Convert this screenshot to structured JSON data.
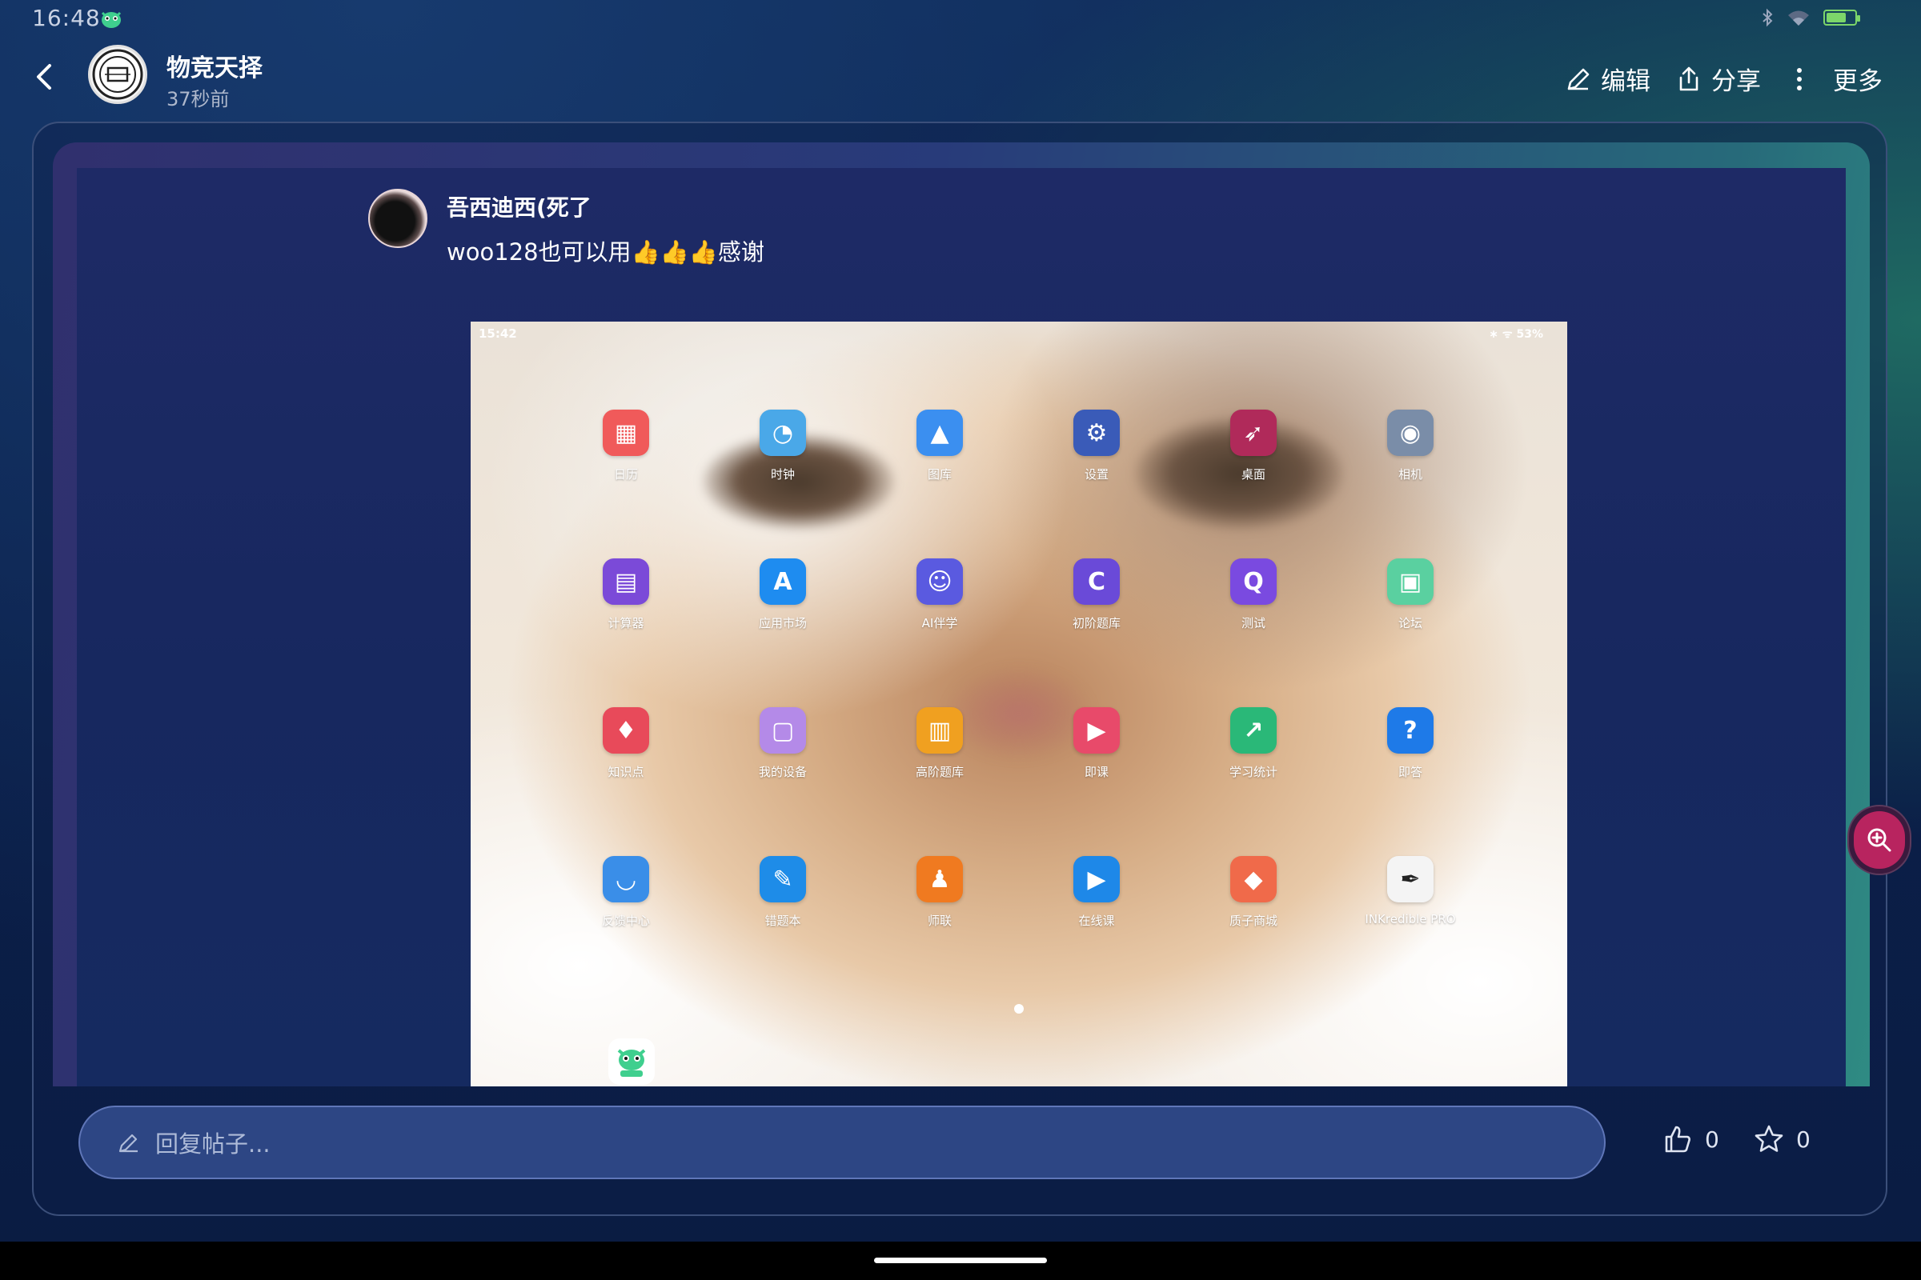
{
  "status_bar": {
    "time": "16:48",
    "app_icon": "green-monster-app-icon",
    "icons": [
      "bluetooth-icon",
      "wifi-icon",
      "battery-icon"
    ]
  },
  "header": {
    "forum_name": "物竞天择",
    "post_time": "37秒前",
    "actions": {
      "edit": "编辑",
      "share": "分享",
      "more": "更多"
    }
  },
  "reply": {
    "username": "吾西迪西(死了",
    "text": "woo128也可以用👍👍👍感谢"
  },
  "image": {
    "status_time": "15:42",
    "status_right": "∗ ᯤ 53%",
    "apps": [
      {
        "label": "日历",
        "icon": "calendar-icon",
        "glyph": "▦",
        "color": "#f05a5a"
      },
      {
        "label": "时钟",
        "icon": "clock-icon",
        "glyph": "◔",
        "color": "#4aa8e8"
      },
      {
        "label": "图库",
        "icon": "gallery-icon",
        "glyph": "▲",
        "color": "#3b8ff0"
      },
      {
        "label": "设置",
        "icon": "settings-icon",
        "glyph": "⚙",
        "color": "#3a5bb8"
      },
      {
        "label": "桌面",
        "icon": "launcher-rocket-icon",
        "glyph": "➶",
        "color": "#b02a5a"
      },
      {
        "label": "相机",
        "icon": "camera-icon",
        "glyph": "◉",
        "color": "#7a8da8"
      },
      {
        "label": "计算器",
        "icon": "calculator-icon",
        "glyph": "▤",
        "color": "#7b4ad8"
      },
      {
        "label": "应用市场",
        "icon": "app-market-icon",
        "glyph": "A",
        "color": "#1e8cf0"
      },
      {
        "label": "AI伴学",
        "icon": "ai-study-icon",
        "glyph": "☺",
        "color": "#5a5ae0"
      },
      {
        "label": "初阶题库",
        "icon": "basic-question-bank-icon",
        "glyph": "C",
        "color": "#6a4ad8"
      },
      {
        "label": "测试",
        "icon": "test-icon",
        "glyph": "Q",
        "color": "#7a4ae0"
      },
      {
        "label": "论坛",
        "icon": "forum-icon",
        "glyph": "▣",
        "color": "#5ad0a0"
      },
      {
        "label": "知识点",
        "icon": "knowledge-point-icon",
        "glyph": "♦",
        "color": "#e84a5a"
      },
      {
        "label": "我的设备",
        "icon": "my-device-icon",
        "glyph": "▢",
        "color": "#b48ae8"
      },
      {
        "label": "高阶题库",
        "icon": "advanced-question-bank-icon",
        "glyph": "▥",
        "color": "#f0a020"
      },
      {
        "label": "即课",
        "icon": "instant-class-icon",
        "glyph": "▶",
        "color": "#e84a6a"
      },
      {
        "label": "学习统计",
        "icon": "study-stats-icon",
        "glyph": "↗",
        "color": "#2ab878"
      },
      {
        "label": "即答",
        "icon": "instant-answer-icon",
        "glyph": "?",
        "color": "#1e7ae8"
      },
      {
        "label": "反馈中心",
        "icon": "feedback-icon",
        "glyph": "◡",
        "color": "#3a8ee8"
      },
      {
        "label": "错题本",
        "icon": "wrong-questions-book-icon",
        "glyph": "✎",
        "color": "#1e8ce8"
      },
      {
        "label": "师联",
        "icon": "teacher-contact-icon",
        "glyph": "♟",
        "color": "#f07a20"
      },
      {
        "label": "在线课",
        "icon": "online-class-icon",
        "glyph": "▶",
        "color": "#1e88e8"
      },
      {
        "label": "质子商城",
        "icon": "proton-mall-icon",
        "glyph": "◆",
        "color": "#f06a4a"
      },
      {
        "label": "INKredible PRO",
        "icon": "inkredible-pro-icon",
        "glyph": "✒",
        "color": "#f4f4f4"
      }
    ],
    "dock_app": "green-monster-app-icon"
  },
  "reply_bar": {
    "placeholder": "回复帖子...",
    "like_count": "0",
    "favorite_count": "0"
  },
  "colors": {
    "accent_zoom": "#b8245f",
    "input_bg": "#2d4684"
  }
}
